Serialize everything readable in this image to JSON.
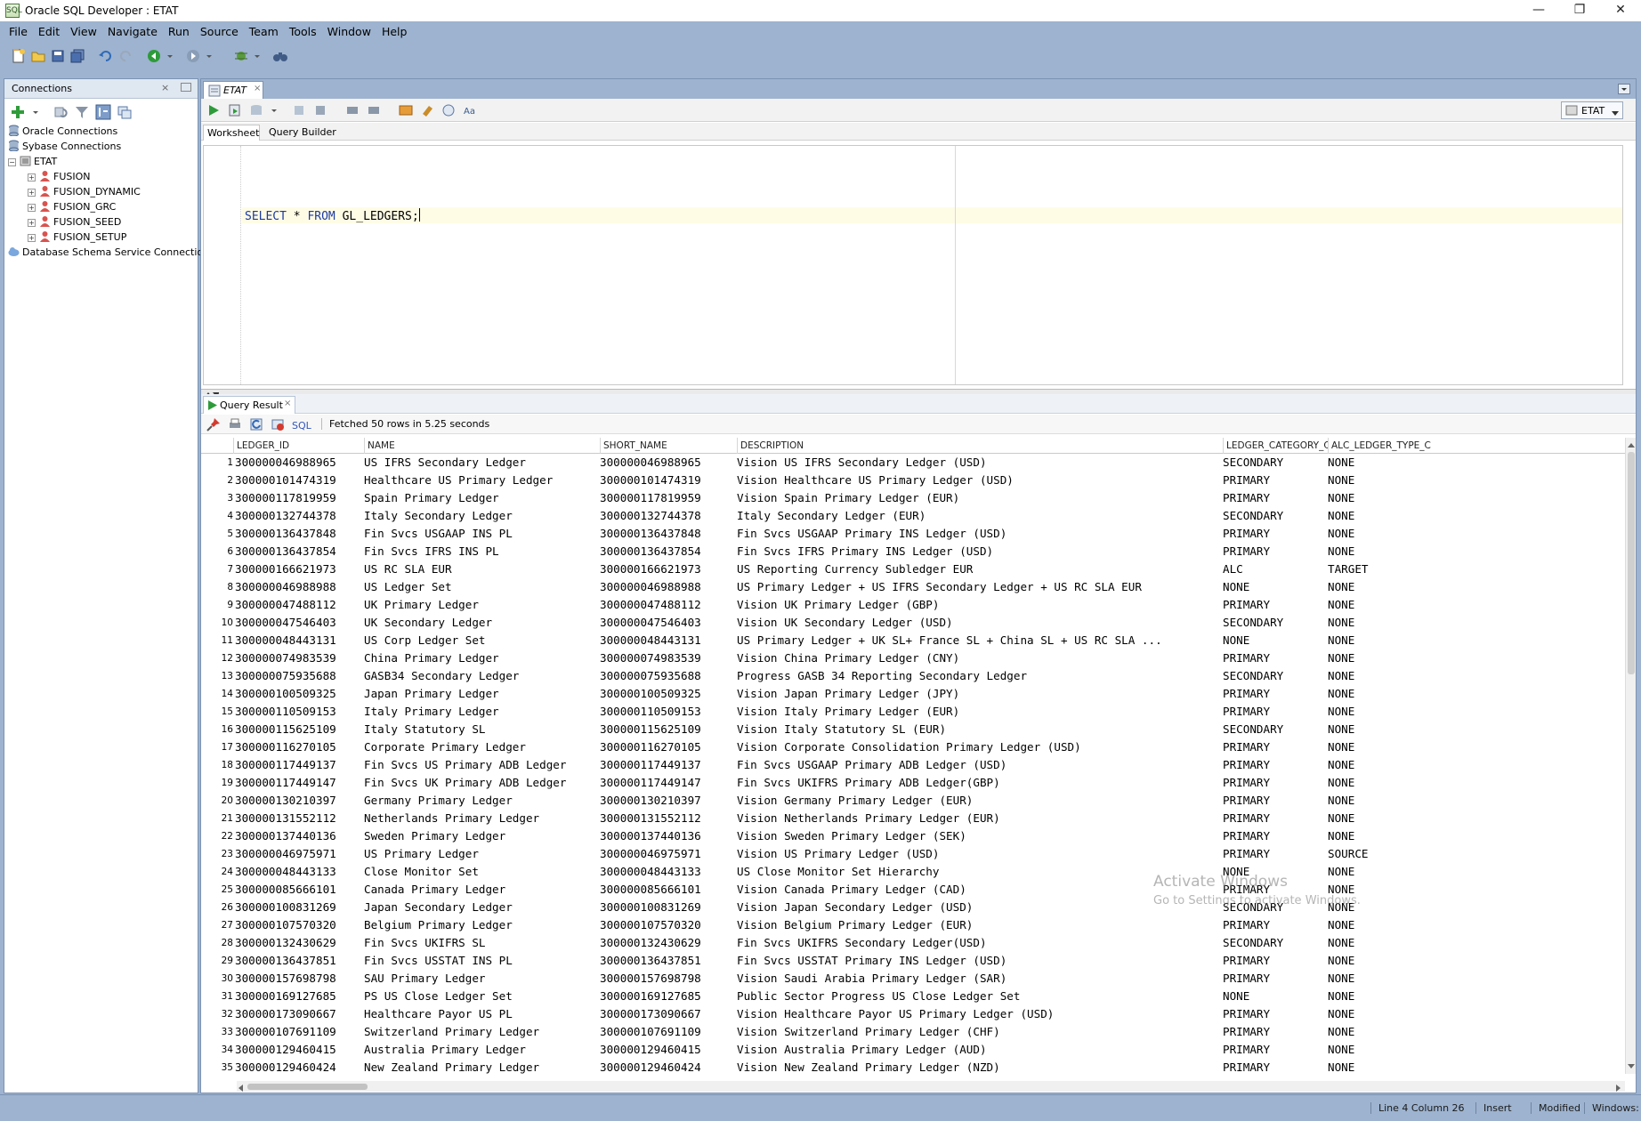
{
  "window": {
    "title": "Oracle SQL Developer : ETAT",
    "app_icon_text": "SQL",
    "controls": [
      "—",
      "❐",
      "✕"
    ]
  },
  "menu": [
    "File",
    "Edit",
    "View",
    "Navigate",
    "Run",
    "Source",
    "Team",
    "Tools",
    "Window",
    "Help"
  ],
  "connections_panel": {
    "title": "Connections",
    "close": "×",
    "tree": [
      {
        "label": "Oracle Connections",
        "level": 0
      },
      {
        "label": "Sybase Connections",
        "level": 0
      },
      {
        "label": "ETAT",
        "level": 0,
        "expanded": true
      },
      {
        "label": "FUSION",
        "level": 1
      },
      {
        "label": "FUSION_DYNAMIC",
        "level": 1
      },
      {
        "label": "FUSION_GRC",
        "level": 1
      },
      {
        "label": "FUSION_SEED",
        "level": 1
      },
      {
        "label": "FUSION_SETUP",
        "level": 1
      },
      {
        "label": "Database Schema Service Connections",
        "level": 0
      }
    ]
  },
  "editor": {
    "doc_tab": "ETAT",
    "doc_tab_close": "×",
    "connection_selector": "ETAT",
    "subtabs": [
      "Worksheet",
      "Query Builder"
    ],
    "sql": {
      "kw1": "SELECT",
      "mid1": " * ",
      "kw2": "FROM",
      "rest": " GL_LEDGERS;"
    }
  },
  "result": {
    "tab": "Query Result",
    "tab_close": "×",
    "sql_link": "SQL",
    "status": "Fetched 50 rows in 5.25 seconds",
    "columns": [
      "LEDGER_ID",
      "NAME",
      "SHORT_NAME",
      "DESCRIPTION",
      "LEDGER_CATEGORY_CODE",
      "ALC_LEDGER_TYPE_C"
    ],
    "rows": [
      [
        "1",
        "300000046988965",
        "US IFRS Secondary Ledger",
        "300000046988965",
        "Vision US IFRS Secondary Ledger (USD)",
        "SECONDARY",
        "NONE"
      ],
      [
        "2",
        "300000101474319",
        "Healthcare US Primary Ledger",
        "300000101474319",
        "Vision Healthcare US Primary Ledger (USD)",
        "PRIMARY",
        "NONE"
      ],
      [
        "3",
        "300000117819959",
        "Spain Primary Ledger",
        "300000117819959",
        "Vision Spain Primary Ledger (EUR)",
        "PRIMARY",
        "NONE"
      ],
      [
        "4",
        "300000132744378",
        "Italy Secondary Ledger",
        "300000132744378",
        "Italy Secondary Ledger (EUR)",
        "SECONDARY",
        "NONE"
      ],
      [
        "5",
        "300000136437848",
        "Fin Svcs USGAAP INS PL",
        "300000136437848",
        "Fin Svcs USGAAP Primary INS Ledger (USD)",
        "PRIMARY",
        "NONE"
      ],
      [
        "6",
        "300000136437854",
        "Fin Svcs IFRS INS PL",
        "300000136437854",
        "Fin Svcs IFRS Primary INS Ledger (USD)",
        "PRIMARY",
        "NONE"
      ],
      [
        "7",
        "300000166621973",
        "US RC SLA EUR",
        "300000166621973",
        "US Reporting Currency Subledger EUR",
        "ALC",
        "TARGET"
      ],
      [
        "8",
        "300000046988988",
        "US Ledger Set",
        "300000046988988",
        "US Primary Ledger + US IFRS Secondary Ledger + US RC SLA EUR",
        "NONE",
        "NONE"
      ],
      [
        "9",
        "300000047488112",
        "UK Primary Ledger",
        "300000047488112",
        "Vision UK Primary Ledger (GBP)",
        "PRIMARY",
        "NONE"
      ],
      [
        "10",
        "300000047546403",
        "UK Secondary Ledger",
        "300000047546403",
        "Vision UK Secondary Ledger (USD)",
        "SECONDARY",
        "NONE"
      ],
      [
        "11",
        "300000048443131",
        "US Corp Ledger Set",
        "300000048443131",
        "US Primary Ledger + UK SL+ France SL + China SL + US RC SLA ...",
        "NONE",
        "NONE"
      ],
      [
        "12",
        "300000074983539",
        "China Primary Ledger",
        "300000074983539",
        "Vision China Primary Ledger (CNY)",
        "PRIMARY",
        "NONE"
      ],
      [
        "13",
        "300000075935688",
        "GASB34 Secondary Ledger",
        "300000075935688",
        "Progress GASB 34 Reporting Secondary Ledger",
        "SECONDARY",
        "NONE"
      ],
      [
        "14",
        "300000100509325",
        "Japan Primary Ledger",
        "300000100509325",
        "Vision Japan Primary Ledger (JPY)",
        "PRIMARY",
        "NONE"
      ],
      [
        "15",
        "300000110509153",
        "Italy Primary Ledger",
        "300000110509153",
        "Vision Italy Primary Ledger (EUR)",
        "PRIMARY",
        "NONE"
      ],
      [
        "16",
        "300000115625109",
        "Italy Statutory SL",
        "300000115625109",
        "Vision Italy Statutory SL (EUR)",
        "SECONDARY",
        "NONE"
      ],
      [
        "17",
        "300000116270105",
        "Corporate Primary Ledger",
        "300000116270105",
        "Vision Corporate Consolidation Primary Ledger (USD)",
        "PRIMARY",
        "NONE"
      ],
      [
        "18",
        "300000117449137",
        "Fin Svcs US Primary ADB Ledger",
        "300000117449137",
        "Fin Svcs USGAAP Primary ADB Ledger (USD)",
        "PRIMARY",
        "NONE"
      ],
      [
        "19",
        "300000117449147",
        "Fin Svcs UK Primary ADB Ledger",
        "300000117449147",
        "Fin Svcs UKIFRS Primary ADB Ledger(GBP)",
        "PRIMARY",
        "NONE"
      ],
      [
        "20",
        "300000130210397",
        "Germany Primary Ledger",
        "300000130210397",
        "Vision Germany Primary Ledger (EUR)",
        "PRIMARY",
        "NONE"
      ],
      [
        "21",
        "300000131552112",
        "Netherlands Primary Ledger",
        "300000131552112",
        "Vision Netherlands Primary Ledger (EUR)",
        "PRIMARY",
        "NONE"
      ],
      [
        "22",
        "300000137440136",
        "Sweden Primary Ledger",
        "300000137440136",
        "Vision Sweden Primary Ledger (SEK)",
        "PRIMARY",
        "NONE"
      ],
      [
        "23",
        "300000046975971",
        "US Primary Ledger",
        "300000046975971",
        "Vision US Primary Ledger (USD)",
        "PRIMARY",
        "SOURCE"
      ],
      [
        "24",
        "300000048443133",
        "Close Monitor Set",
        "300000048443133",
        "US Close Monitor Set Hierarchy",
        "NONE",
        "NONE"
      ],
      [
        "25",
        "300000085666101",
        "Canada Primary Ledger",
        "300000085666101",
        "Vision Canada Primary Ledger (CAD)",
        "PRIMARY",
        "NONE"
      ],
      [
        "26",
        "300000100831269",
        "Japan Secondary Ledger",
        "300000100831269",
        "Vision Japan Secondary Ledger (USD)",
        "SECONDARY",
        "NONE"
      ],
      [
        "27",
        "300000107570320",
        "Belgium Primary Ledger",
        "300000107570320",
        "Vision Belgium Primary Ledger (EUR)",
        "PRIMARY",
        "NONE"
      ],
      [
        "28",
        "300000132430629",
        "Fin Svcs UKIFRS SL",
        "300000132430629",
        "Fin Svcs UKIFRS Secondary Ledger(USD)",
        "SECONDARY",
        "NONE"
      ],
      [
        "29",
        "300000136437851",
        "Fin Svcs USSTAT INS PL",
        "300000136437851",
        "Fin Svcs USSTAT Primary INS Ledger (USD)",
        "PRIMARY",
        "NONE"
      ],
      [
        "30",
        "300000157698798",
        "SAU Primary Ledger",
        "300000157698798",
        "Vision Saudi Arabia Primary Ledger (SAR)",
        "PRIMARY",
        "NONE"
      ],
      [
        "31",
        "300000169127685",
        "PS US Close Ledger Set",
        "300000169127685",
        "Public Sector Progress US Close Ledger Set",
        "NONE",
        "NONE"
      ],
      [
        "32",
        "300000173090667",
        "Healthcare Payor US PL",
        "300000173090667",
        "Vision Healthcare Payor US Primary Ledger (USD)",
        "PRIMARY",
        "NONE"
      ],
      [
        "33",
        "300000107691109",
        "Switzerland Primary Ledger",
        "300000107691109",
        "Vision Switzerland Primary Ledger (CHF)",
        "PRIMARY",
        "NONE"
      ],
      [
        "34",
        "300000129460415",
        "Australia Primary Ledger",
        "300000129460415",
        "Vision Australia Primary Ledger (AUD)",
        "PRIMARY",
        "NONE"
      ],
      [
        "35",
        "300000129460424",
        "New Zealand Primary Ledger",
        "300000129460424",
        "Vision New Zealand Primary Ledger (NZD)",
        "PRIMARY",
        "NONE"
      ]
    ]
  },
  "watermark": {
    "line1": "Activate Windows",
    "line2": "Go to Settings to activate Windows."
  },
  "statusbar": {
    "position": "Line 4 Column 26",
    "mode": "Insert",
    "modified": "Modified",
    "os": "Windows: C"
  },
  "colors": {
    "chrome": "#9db3cf",
    "keyword": "#1b3aa3",
    "current_line": "#fffce6"
  }
}
